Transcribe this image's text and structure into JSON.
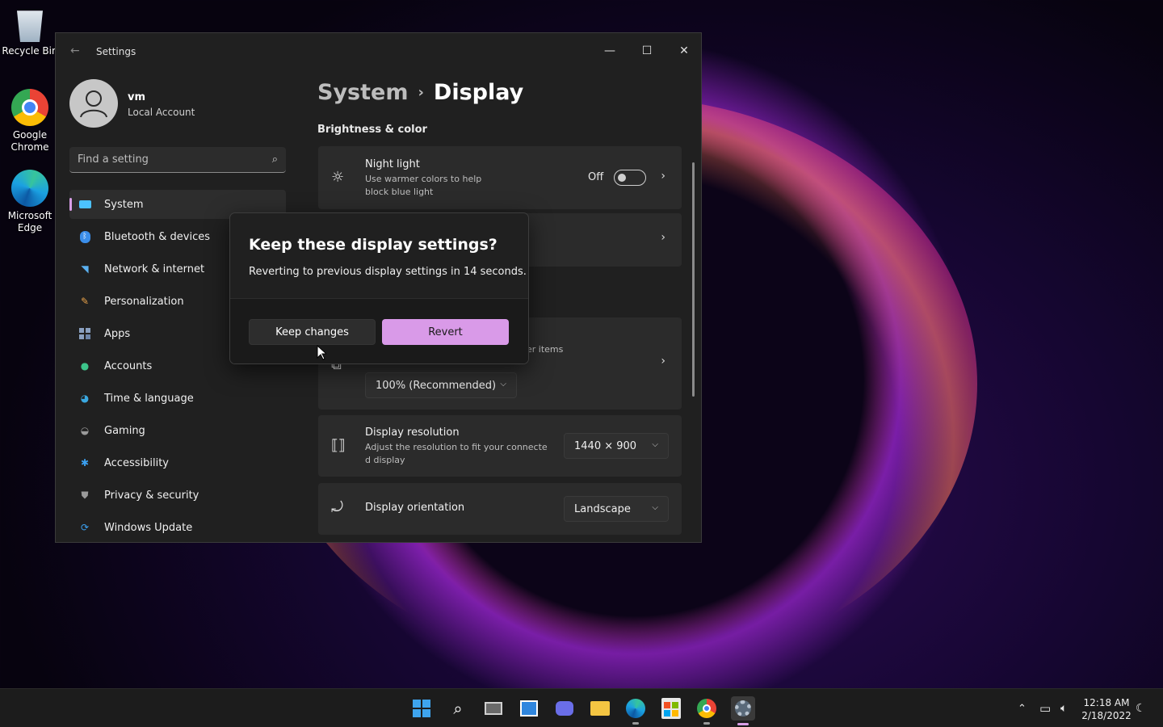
{
  "desktop": {
    "icons": [
      {
        "label": "Recycle Bin"
      },
      {
        "label": "Google Chrome"
      },
      {
        "label": "Microsoft Edge"
      }
    ]
  },
  "window": {
    "title": "Settings",
    "controls": {
      "minimize": "—",
      "maximize": "☐",
      "close": "✕"
    }
  },
  "profile": {
    "name": "vm",
    "account_type": "Local Account"
  },
  "search": {
    "placeholder": "Find a setting"
  },
  "sidebar": {
    "items": [
      {
        "label": "System",
        "icon": "system-icon",
        "color": "#4cc2ff",
        "active": true
      },
      {
        "label": "Bluetooth & devices",
        "icon": "bluetooth-icon",
        "color": "#3b8eea"
      },
      {
        "label": "Network & internet",
        "icon": "wifi-icon",
        "color": "#5ab0f0"
      },
      {
        "label": "Personalization",
        "icon": "brush-icon",
        "color": "#e8a24a"
      },
      {
        "label": "Apps",
        "icon": "apps-icon",
        "color": "#8aa0c0"
      },
      {
        "label": "Accounts",
        "icon": "accounts-icon",
        "color": "#3cc48a"
      },
      {
        "label": "Time & language",
        "icon": "globe-clock-icon",
        "color": "#3aa8e0"
      },
      {
        "label": "Gaming",
        "icon": "gamepad-icon",
        "color": "#9a9a9a"
      },
      {
        "label": "Accessibility",
        "icon": "accessibility-icon",
        "color": "#3ba0f0"
      },
      {
        "label": "Privacy & security",
        "icon": "shield-icon",
        "color": "#9a9a9a"
      },
      {
        "label": "Windows Update",
        "icon": "update-icon",
        "color": "#3ba0f0"
      }
    ]
  },
  "content": {
    "breadcrumb": {
      "parent": "System",
      "separator": "›",
      "current": "Display"
    },
    "section": "Brightness & color",
    "night_light": {
      "title": "Night light",
      "subtitle_line1": "Use warmer colors to help",
      "subtitle_line2": "block blue light",
      "state": "Off"
    },
    "scale_partial_text": "er items",
    "scale_value": "100% (Recommended)",
    "resolution": {
      "title": "Display resolution",
      "subtitle_line1": "Adjust the resolution to fit your connecte",
      "subtitle_line2": "d display",
      "value": "1440 × 900"
    },
    "orientation": {
      "title": "Display orientation",
      "value": "Landscape"
    }
  },
  "dialog": {
    "title": "Keep these display settings?",
    "body": "Reverting to previous display settings in 14 seconds.",
    "keep_label": "Keep changes",
    "revert_label": "Revert",
    "accent": "#d99ae8"
  },
  "taskbar": {
    "apps": [
      "start-icon",
      "search-icon",
      "task-view-icon",
      "widgets-icon",
      "chat-icon",
      "file-explorer-icon",
      "edge-icon",
      "store-icon",
      "chrome-icon",
      "settings-icon"
    ],
    "clock": {
      "time": "12:18 AM",
      "date": "2/18/2022"
    }
  }
}
